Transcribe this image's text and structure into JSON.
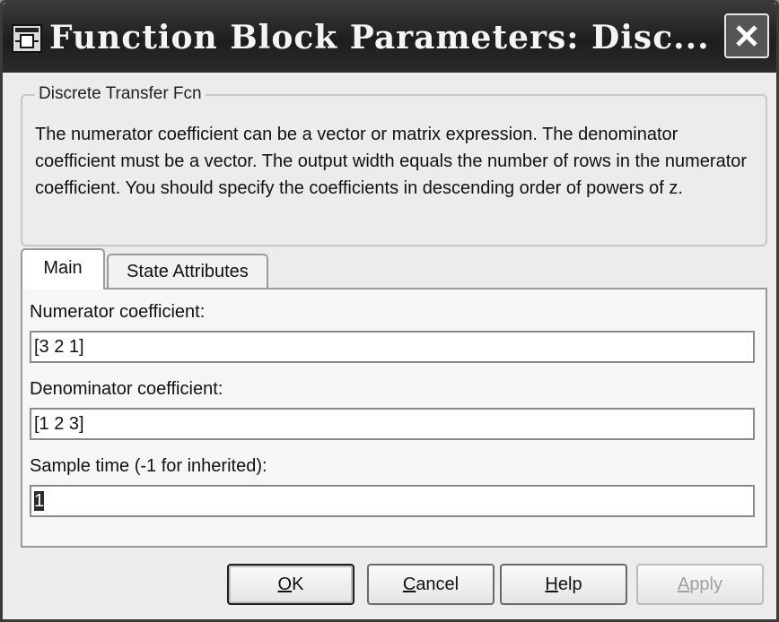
{
  "window": {
    "title": "Function Block Parameters: Disc...",
    "icon": "simulink-block-icon",
    "close_icon": "close-icon"
  },
  "block": {
    "name": "Discrete Transfer Fcn",
    "description": "The numerator coefficient can be a vector or matrix expression. The denominator coefficient must be a vector. The output width equals the number of rows in the numerator coefficient. You should specify the coefficients in descending order of powers of z."
  },
  "tabs": [
    {
      "label": "Main",
      "active": true
    },
    {
      "label": "State Attributes",
      "active": false
    }
  ],
  "fields": {
    "numerator": {
      "label": "Numerator coefficient:",
      "value": "[3 2 1]"
    },
    "denominator": {
      "label": "Denominator coefficient:",
      "value": "[1 2 3]"
    },
    "sample_time": {
      "label": "Sample time (-1 for inherited):",
      "value": "1"
    }
  },
  "buttons": {
    "ok": {
      "mnemonic": "O",
      "rest": "K"
    },
    "cancel": {
      "mnemonic": "C",
      "rest": "ancel"
    },
    "help": {
      "mnemonic": "H",
      "rest": "elp"
    },
    "apply": {
      "mnemonic": "A",
      "rest": "pply",
      "enabled": false
    }
  }
}
